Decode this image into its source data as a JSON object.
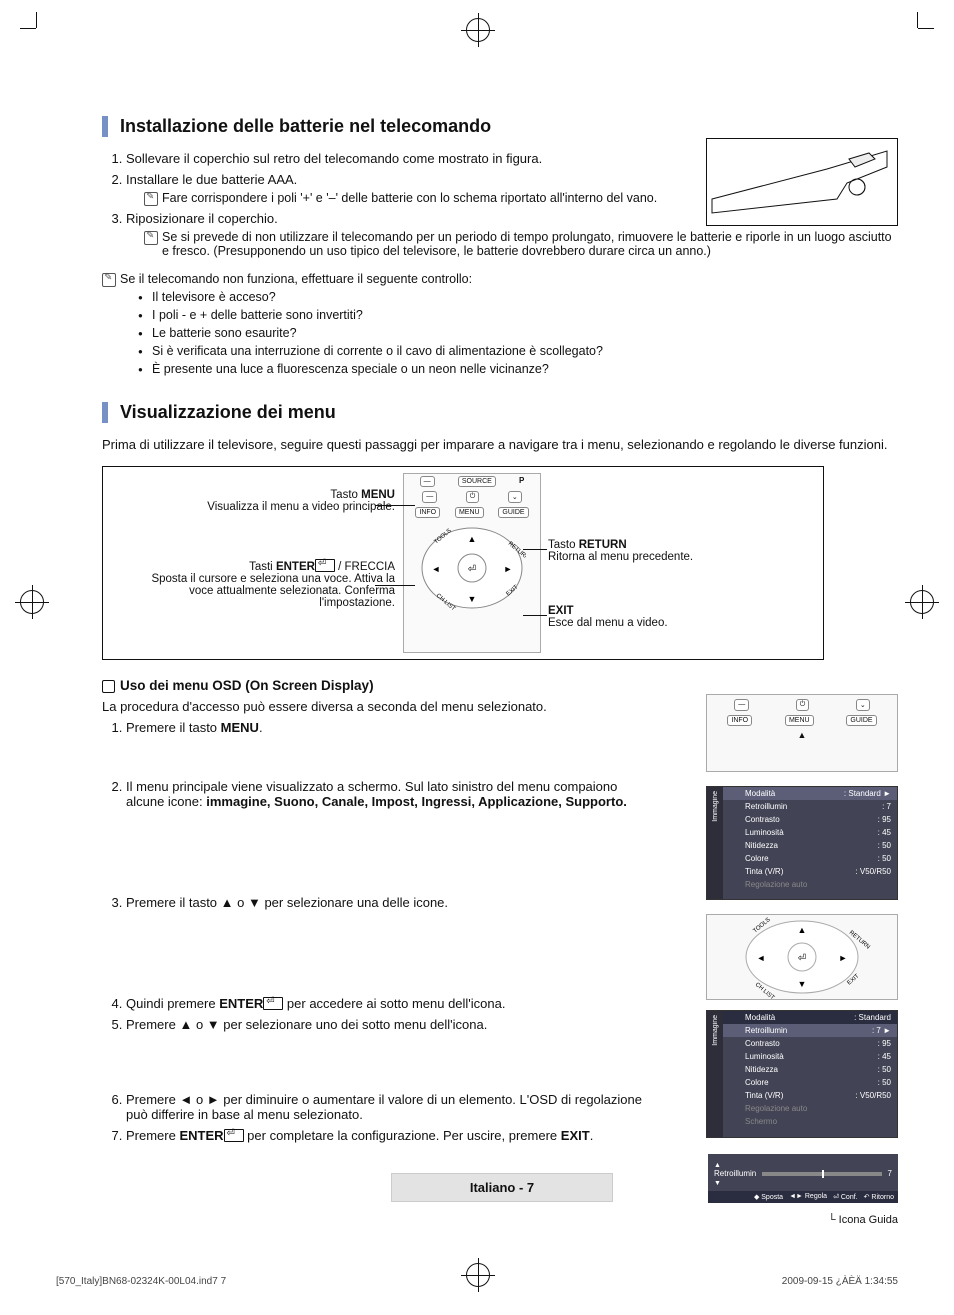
{
  "section1": {
    "title": "Installazione delle batterie nel telecomando",
    "steps": [
      {
        "text": "Sollevare il coperchio sul retro del telecomando come mostrato in figura."
      },
      {
        "text": "Installare le due batterie AAA.",
        "note": "Fare corrispondere i poli '+' e '–' delle batterie con lo schema riportato all'interno del vano."
      },
      {
        "text": "Riposizionare il coperchio.",
        "note": "Se si prevede di non utilizzare il telecomando per un periodo di tempo prolungato, rimuovere le batterie e riporle in un luogo asciutto e fresco. (Presupponendo un uso tipico del televisore, le batterie dovrebbero durare circa un anno.)"
      }
    ],
    "troubleshoot_lead": "Se il telecomando non funziona, effettuare il seguente controllo:",
    "bullets": [
      "Il televisore è acceso?",
      "I poli - e + delle batterie sono invertiti?",
      "Le batterie sono esaurite?",
      "Si è verificata una interruzione di corrente o il cavo di alimentazione è scollegato?",
      "È presente una luce a fluorescenza speciale o un neon nelle vicinanze?"
    ]
  },
  "section2": {
    "title": "Visualizzazione dei menu",
    "intro": "Prima di utilizzare il televisore, seguire questi passaggi per imparare a navigare tra i menu, selezionando e regolando le diverse funzioni.",
    "remote_buttons": {
      "source": "SOURCE",
      "info": "INFO",
      "menu": "MENU",
      "guide": "GUIDE"
    },
    "labels": {
      "menu_key": "Tasto",
      "menu_strong": "MENU",
      "menu_desc": "Visualizza il menu a video principale.",
      "enter_key": "Tasti",
      "enter_strong": "ENTER",
      "arrow": "/ FRECCIA",
      "enter_desc": "Sposta il cursore e seleziona una voce. Attiva la voce attualmente selezionata. Conferma l'impostazione.",
      "return_key": "Tasto",
      "return_strong": "RETURN",
      "return_desc": "Ritorna al menu precedente.",
      "exit_strong": "EXIT",
      "exit_desc": "Esce dal menu a video."
    },
    "osd_title": "Uso dei menu OSD (On Screen Display)",
    "osd_intro": "La procedura d'accesso può essere diversa a seconda del menu selezionato.",
    "steps": [
      {
        "pre": "Premere il tasto",
        "bold": "MENU",
        "post": "."
      },
      {
        "pre": "Il menu principale viene visualizzato a schermo. Sul lato sinistro del menu compaiono alcune icone:",
        "bold": "immagine, Suono, Canale, Impost, Ingressi, Applicazione, Supporto."
      },
      {
        "text": "Premere il tasto ▲ o ▼ per selezionare una delle icone."
      },
      {
        "pre": "Quindi premere",
        "bold": "ENTER",
        "post": "per accedere ai sotto menu dell'icona."
      },
      {
        "text": "Premere ▲ o ▼ per selezionare uno dei sotto menu dell'icona."
      },
      {
        "text": "Premere ◄ o ► per diminuire o aumentare il valore di un elemento. L'OSD di regolazione può differire in base al menu selezionato."
      },
      {
        "pre": "Premere",
        "b1": "ENTER",
        "mid": "per completare la configurazione. Per uscire, premere",
        "b2": "EXIT",
        "post": "."
      }
    ]
  },
  "osd": {
    "side_label": "Immagine",
    "rows": [
      {
        "k": "Modalità",
        "v": ": Standard"
      },
      {
        "k": "Retroillumin",
        "v": ": 7"
      },
      {
        "k": "Contrasto",
        "v": ": 95"
      },
      {
        "k": "Luminosità",
        "v": ": 45"
      },
      {
        "k": "Nitidezza",
        "v": ": 50"
      },
      {
        "k": "Colore",
        "v": ": 50"
      },
      {
        "k": "Tinta (V/R)",
        "v": ": V50/R50"
      },
      {
        "k": "Regolazione auto",
        "v": ""
      },
      {
        "k": "Schermo",
        "v": ""
      }
    ],
    "adjust": {
      "label": "Retroillumin",
      "value": "7",
      "btns": [
        "Sposta",
        "Regola",
        "Conf.",
        "Ritorno"
      ]
    },
    "guide_icon_label": "Icona Guida"
  },
  "footer": {
    "page_label": "Italiano - 7",
    "file": "[570_Italy]BN68-02324K-00L04.ind7   7",
    "date": "2009-09-15   ¿ÀÈÄ 1:34:55"
  }
}
